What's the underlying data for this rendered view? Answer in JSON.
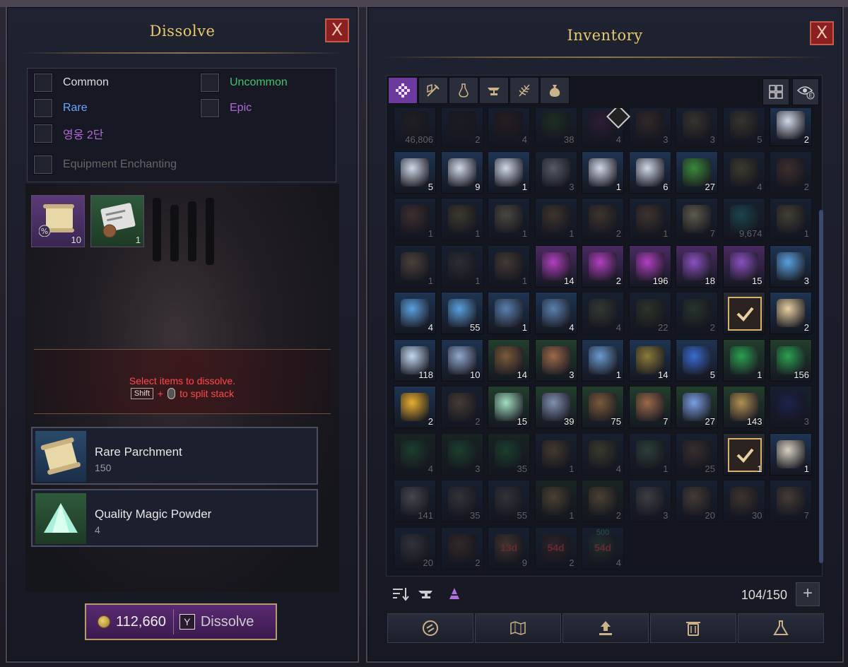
{
  "dissolve": {
    "title": "Dissolve",
    "close_label": "X",
    "filters": [
      {
        "label": "Common",
        "color": "#dddddd"
      },
      {
        "label": "Uncommon",
        "color": "#3fc46a"
      },
      {
        "label": "Rare",
        "color": "#6aa8ff"
      },
      {
        "label": "Epic",
        "color": "#b26ad8"
      },
      {
        "label": "영웅 2단",
        "color": "#b26ad8"
      },
      {
        "label": "Equipment Enchanting",
        "color": "#666666"
      }
    ],
    "selected_materials": [
      {
        "icon": "parchment-percent-icon",
        "count": "10",
        "rarity": "epic"
      },
      {
        "icon": "craft-scroll-icon",
        "count": "1",
        "rarity": "uncommon"
      }
    ],
    "hint": {
      "line1": "Select items to dissolve.",
      "key": "Shift",
      "plus": "+",
      "line2_suffix": "to split stack"
    },
    "results": [
      {
        "name": "Rare Parchment",
        "qty": "150",
        "icon": "parchment-icon"
      },
      {
        "name": "Quality Magic Powder",
        "qty": "4",
        "icon": "magic-powder-icon"
      }
    ],
    "cost": "112,660",
    "button_key": "Y",
    "button_label": "Dissolve"
  },
  "inventory": {
    "title": "Inventory",
    "close_label": "X",
    "tabs": [
      "all-items-icon",
      "weapon-armor-icon",
      "potion-icon",
      "anvil-icon",
      "herb-icon",
      "pouch-icon"
    ],
    "slot_count": "104/150",
    "rows": [
      [
        [
          "#3a3030",
          "46,806",
          1
        ],
        [
          "#2a2a2a",
          "2",
          1
        ],
        [
          "#4a2a2a",
          "4",
          1
        ],
        [
          "#2e5a2e",
          "38",
          1
        ],
        [
          "#5a2a5a",
          "4",
          1
        ],
        [
          "#6a4a3a",
          "3",
          1
        ],
        [
          "#7a6a4a",
          "3",
          1
        ],
        [
          "#7a6a4a",
          "5",
          1
        ],
        [
          "#d0d8e8",
          "2",
          0
        ]
      ],
      [
        [
          "#d0d8e8",
          "5",
          0
        ],
        [
          "#d0d8e8",
          "9",
          0
        ],
        [
          "#d0d8e8",
          "1",
          0
        ],
        [
          "#d0d8e8",
          "3",
          1
        ],
        [
          "#d0d8e8",
          "1",
          0
        ],
        [
          "#d0d8e8",
          "6",
          0
        ],
        [
          "#3a8a3a",
          "27",
          0
        ],
        [
          "#8a7a4a",
          "4",
          1
        ],
        [
          "#8a5a4a",
          "2",
          1
        ]
      ],
      [
        [
          "#8a5a4a",
          "1",
          1
        ],
        [
          "#8a7a4a",
          "1",
          1
        ],
        [
          "#b0a080",
          "1",
          1
        ],
        [
          "#8a6a4a",
          "1",
          1
        ],
        [
          "#8a6a4a",
          "2",
          1
        ],
        [
          "#8a6a4a",
          "1",
          1
        ],
        [
          "#e8d8a0",
          "7",
          1
        ],
        [
          "#2a9aa0",
          "9,674",
          1
        ],
        [
          "#9a8a5a",
          "1",
          1
        ]
      ],
      [
        [
          "#b09070",
          "1",
          1
        ],
        [
          "#5a5a5a",
          "1",
          1
        ],
        [
          "#9a7a5a",
          "1",
          1
        ],
        [
          "#b040c0",
          "14",
          0
        ],
        [
          "#b040c0",
          "2",
          0
        ],
        [
          "#b040c0",
          "196",
          0
        ],
        [
          "#8a50c0",
          "18",
          0
        ],
        [
          "#8a50c0",
          "15",
          0
        ],
        [
          "#5aa0e0",
          "3",
          0
        ]
      ],
      [
        [
          "#5aa0e0",
          "4",
          0
        ],
        [
          "#5aa0e0",
          "55",
          0
        ],
        [
          "#5a80b0",
          "1",
          0
        ],
        [
          "#5a80b0",
          "4",
          0
        ],
        [
          "#6a7a5a",
          "4",
          1
        ],
        [
          "#5a6a3a",
          "22",
          1
        ],
        [
          "#4a6a4a",
          "2",
          1
        ],
        [
          "check",
          "",
          0
        ],
        [
          "#e8d0a0",
          "2",
          0
        ]
      ],
      [
        [
          "#c0d8f0",
          "118",
          0
        ],
        [
          "#90a8d0",
          "10",
          0
        ],
        [
          "#7a5a3a",
          "14",
          0
        ],
        [
          "#9a6a4a",
          "3",
          0
        ],
        [
          "#6a9ad0",
          "1",
          0
        ],
        [
          "#8a7a3a",
          "14",
          0
        ],
        [
          "#3a6ad0",
          "5",
          0
        ],
        [
          "#2aa050",
          "1",
          0
        ],
        [
          "#2aa050",
          "156",
          0
        ]
      ],
      [
        [
          "#e8b030",
          "2",
          0
        ],
        [
          "#a08060",
          "2",
          1
        ],
        [
          "#a0e0c0",
          "15",
          0
        ],
        [
          "#8090b0",
          "39",
          0
        ],
        [
          "#7a5a3a",
          "75",
          0
        ],
        [
          "#9a6a4a",
          "7",
          0
        ],
        [
          "#7aa0e0",
          "27",
          0
        ],
        [
          "#b09050",
          "143",
          0
        ],
        [
          "#2a3aa0",
          "3",
          1
        ]
      ],
      [
        [
          "#2a8a4a",
          "4",
          1
        ],
        [
          "#2a8a4a",
          "3",
          1
        ],
        [
          "#2a8a4a",
          "35",
          1
        ],
        [
          "#9a7a4a",
          "1",
          1
        ],
        [
          "#7a7a4a",
          "4",
          1
        ],
        [
          "#5a8a6a",
          "1",
          1
        ],
        [
          "#7a5a4a",
          "25",
          1
        ],
        [
          "check",
          "1",
          0
        ],
        [
          "#d8d0c0",
          "1",
          0
        ]
      ],
      [
        [
          "#a0a0a0",
          "141",
          1
        ],
        [
          "#6a6a6a",
          "35",
          1
        ],
        [
          "#6a6a6a",
          "55",
          1
        ],
        [
          "#b09050",
          "1",
          1
        ],
        [
          "#b09050",
          "2",
          1
        ],
        [
          "#8a8a8a",
          "3",
          1
        ],
        [
          "#a08060",
          "20",
          1
        ],
        [
          "#8a6a4a",
          "30",
          1
        ],
        [
          "#a08060",
          "7",
          1
        ]
      ],
      [
        [
          "#6a6a6a",
          "20",
          1
        ],
        [
          "#6a4a3a",
          "2",
          1
        ],
        [
          "#8a6a4a",
          "9",
          1
        ],
        [
          "#5a3a3a",
          "2",
          1
        ],
        [
          "#3a5a4a",
          "4",
          1
        ],
        null,
        null,
        null,
        null
      ]
    ],
    "timers": {
      "9-2": "13d",
      "9-3": "54d",
      "9-4": "54d",
      "9-4-top": "500"
    }
  }
}
